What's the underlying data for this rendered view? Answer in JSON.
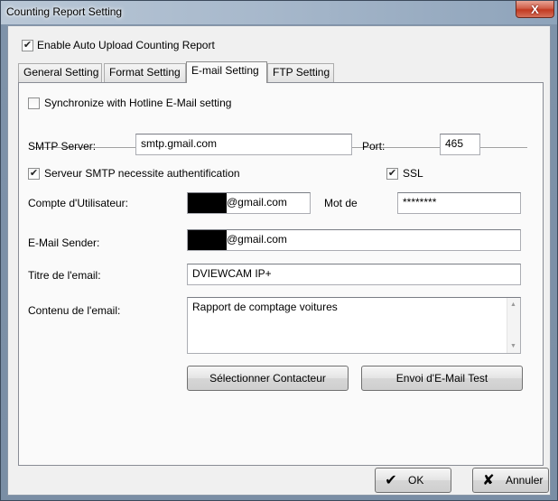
{
  "window": {
    "title": "Counting Report Setting",
    "close_label": "X"
  },
  "enable_auto_upload": {
    "label": "Enable Auto Upload Counting Report",
    "checked": true
  },
  "tabs": [
    {
      "label": "General Setting",
      "active": false
    },
    {
      "label": "Format Setting",
      "active": false
    },
    {
      "label": "E-mail Setting",
      "active": true
    },
    {
      "label": "FTP Setting",
      "active": false
    }
  ],
  "email": {
    "sync_hotline": {
      "label": "Synchronize with Hotline E-Mail setting",
      "checked": false
    },
    "smtp_server": {
      "label": "SMTP Server:",
      "value": "smtp.gmail.com"
    },
    "port": {
      "label": "Port:",
      "value": "465"
    },
    "auth_required": {
      "label": "Serveur SMTP necessite authentification",
      "checked": true
    },
    "ssl": {
      "label": "SSL",
      "checked": true
    },
    "user_account": {
      "label": "Compte d'Utilisateur:",
      "value": "@gmail.com"
    },
    "password": {
      "label": "Mot de",
      "value": "********"
    },
    "sender": {
      "label": "E-Mail Sender:",
      "value": "@gmail.com"
    },
    "subject": {
      "label": "Titre de l'email:",
      "value": "DVIEWCAM IP+"
    },
    "body": {
      "label": "Contenu de l'email:",
      "value": "Rapport de comptage voitures"
    },
    "select_contact_label": "Sélectionner Contacteur",
    "send_test_label": "Envoi d'E-Mail Test"
  },
  "footer": {
    "ok_label": "OK",
    "cancel_label": "Annuler"
  },
  "icons": {
    "check": "✔",
    "ok_icon": "checkmark-icon",
    "cancel_icon": "x-icon"
  }
}
